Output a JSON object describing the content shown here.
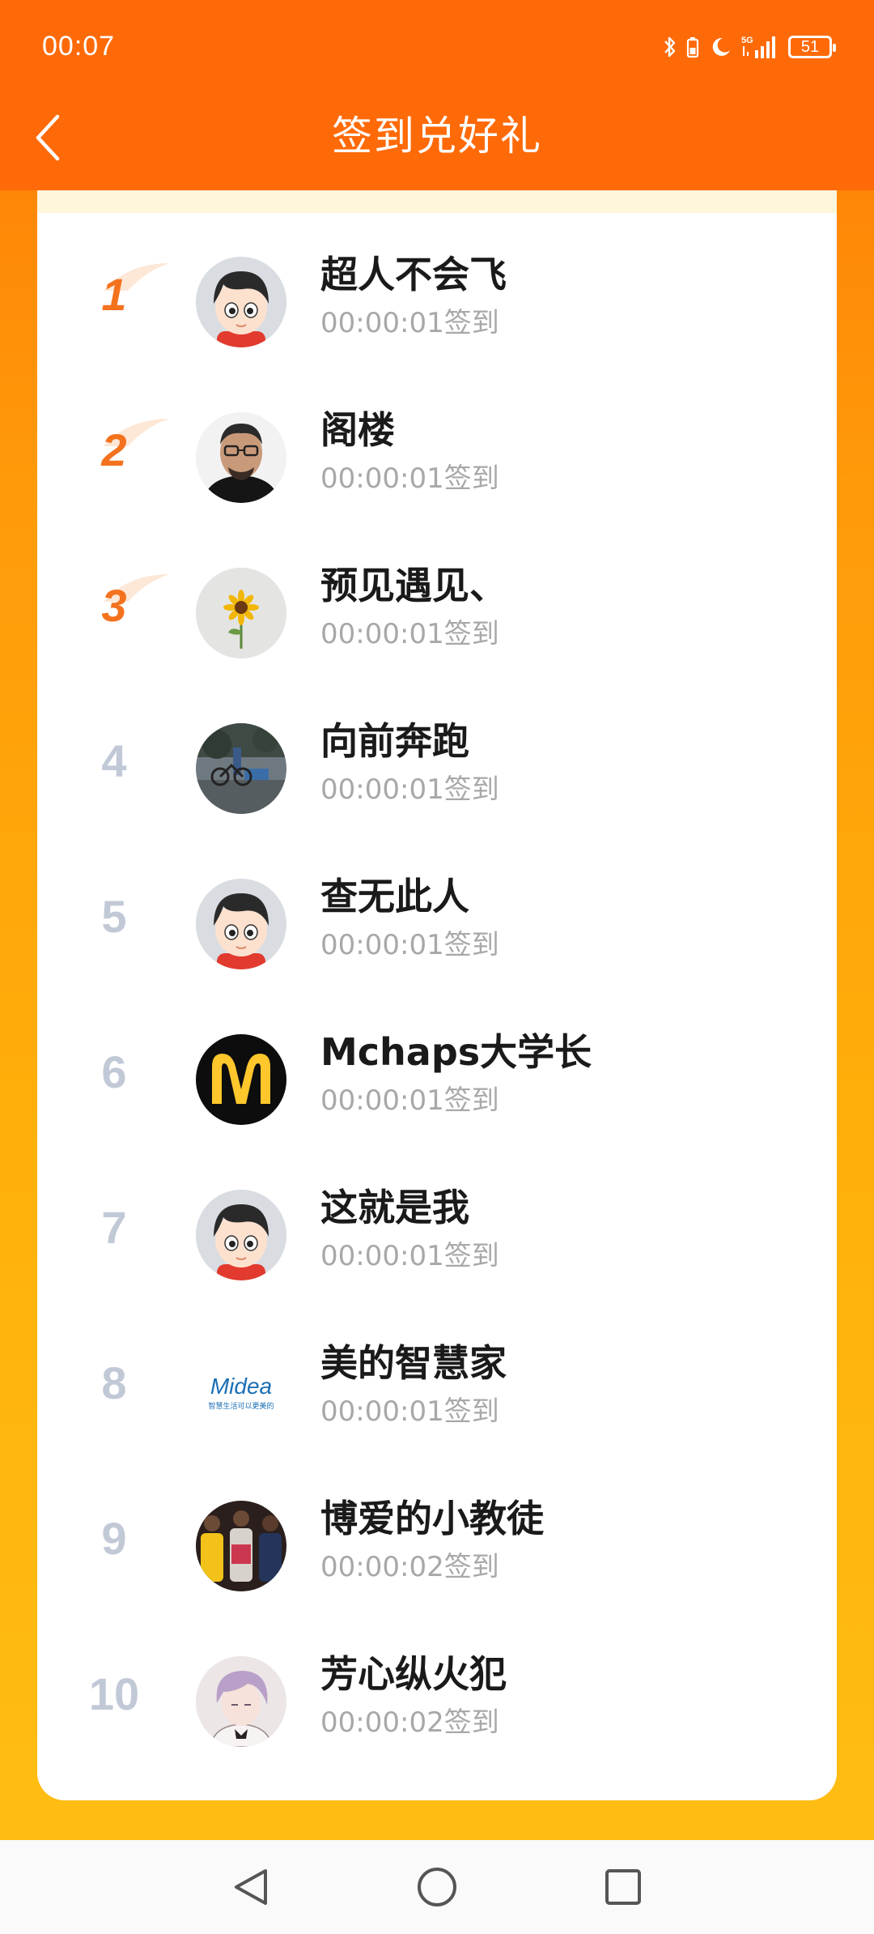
{
  "status_bar": {
    "time": "00:07",
    "network": "5G",
    "battery": "51",
    "icons": [
      "bluetooth-icon",
      "battery-saver-icon",
      "moon-icon",
      "signal-icon",
      "battery-icon"
    ]
  },
  "header": {
    "title": "签到兑好礼",
    "back_icon": "chevron-left-icon",
    "background_color": "#ff6a08"
  },
  "colors": {
    "accent_rank": "#f4721e",
    "rank_gray": "#c2c9d6",
    "panel_bg": "#ffffff",
    "page_gradient_top": "#ff7a06",
    "page_gradient_bottom": "#ffbd12"
  },
  "ranking": [
    {
      "rank": "1",
      "name": "超人不会飞",
      "time": "00:00:01签到",
      "avatar": "cartoon-boy"
    },
    {
      "rank": "2",
      "name": "阁楼",
      "time": "00:00:01签到",
      "avatar": "man-glasses-photo"
    },
    {
      "rank": "3",
      "name": "预见遇见、",
      "time": "00:00:01签到",
      "avatar": "sunflower-photo"
    },
    {
      "rank": "4",
      "name": "向前奔跑",
      "time": "00:00:01签到",
      "avatar": "street-photo"
    },
    {
      "rank": "5",
      "name": "查无此人",
      "time": "00:00:01签到",
      "avatar": "cartoon-boy"
    },
    {
      "rank": "6",
      "name": "Mchaps大学长",
      "time": "00:00:01签到",
      "avatar": "mcdonalds-logo"
    },
    {
      "rank": "7",
      "name": "这就是我",
      "time": "00:00:01签到",
      "avatar": "cartoon-boy"
    },
    {
      "rank": "8",
      "name": "美的智慧家",
      "time": "00:00:01签到",
      "avatar": "midea-logo",
      "avatar_text": {
        "brand": "Midea",
        "slogan": "智慧生活可以更美的"
      }
    },
    {
      "rank": "9",
      "name": "博爱的小教徒",
      "time": "00:00:02签到",
      "avatar": "basketball-players-photo"
    },
    {
      "rank": "10",
      "name": "芳心纵火犯",
      "time": "00:00:02签到",
      "avatar": "anime-boy-drawing"
    }
  ],
  "system_nav": {
    "buttons": [
      "back-triangle-icon",
      "home-circle-icon",
      "recents-square-icon"
    ]
  }
}
